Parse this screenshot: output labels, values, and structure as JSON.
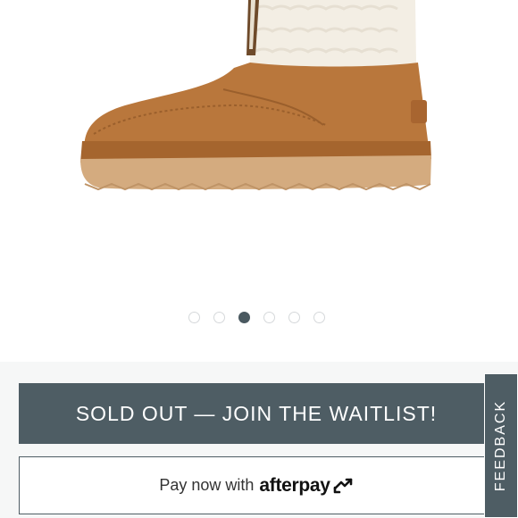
{
  "product_gallery": {
    "image_icon": "suede-boot-with-shearling-cuff",
    "dots": [
      {
        "active": false
      },
      {
        "active": false
      },
      {
        "active": true
      },
      {
        "active": false
      },
      {
        "active": false
      },
      {
        "active": false
      }
    ]
  },
  "actions": {
    "waitlist_label": "SOLD OUT — JOIN THE WAITLIST!",
    "afterpay_prefix": "Pay now with",
    "afterpay_brand": "afterpay",
    "afterpay_icon": "afterpay-arrows-icon"
  },
  "feedback": {
    "label": "FEEDBACK"
  },
  "colors": {
    "button_slate": "#4e5d64",
    "suede": "#b9773c",
    "sole": "#d4ab7f",
    "shearling": "#f3eee4"
  }
}
